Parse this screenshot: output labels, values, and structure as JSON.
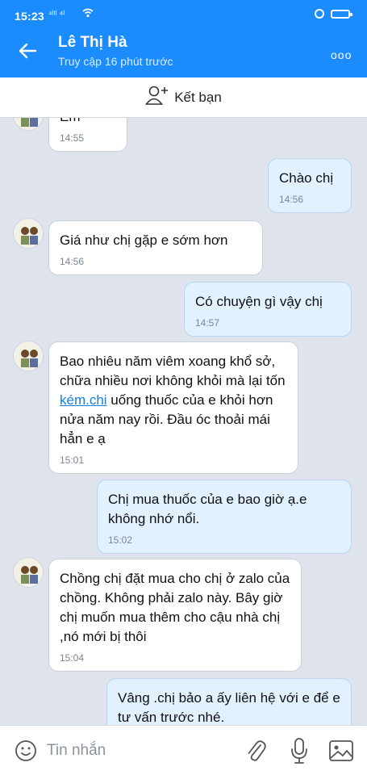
{
  "status_bar": {
    "time": "15:23",
    "signal": "⁴ˡᵗˡ ⁴ˡ"
  },
  "header": {
    "contact_name": "Lê Thị Hà",
    "last_seen": "Truy cập 16 phút trước",
    "more_label": "ooo"
  },
  "add_friend": {
    "label": "Kết bạn"
  },
  "messages": [
    {
      "dir": "in",
      "text": "Em",
      "time": "14:55"
    },
    {
      "dir": "out",
      "text": "Chào chị",
      "time": "14:56"
    },
    {
      "dir": "in",
      "text": "Giá như chị gặp e sớm hơn",
      "time": "14:56"
    },
    {
      "dir": "out",
      "text": "Có chuyện gì vậy chị",
      "time": "14:57"
    },
    {
      "dir": "in",
      "text_before": "Bao nhiêu năm viêm xoang khổ sở, chữa nhiều nơi không khỏi mà lại tốn ",
      "link": "kém.chi",
      "text_after": " uống thuốc của e khỏi hơn nửa năm nay rồi. Đầu óc thoải mái hẳn e ạ",
      "time": "15:01"
    },
    {
      "dir": "out",
      "text": "Chị mua thuốc của e bao giờ ạ.e không nhớ nổi.",
      "time": "15:02"
    },
    {
      "dir": "in",
      "text": "Chồng chị đặt mua cho chị ở zalo của chồng. Không phải zalo này. Bây giờ chị muốn mua thêm cho cậu nhà chị ,nó mới bị thôi",
      "time": "15:04"
    },
    {
      "dir": "out",
      "text": "Vâng .chị bảo a ấy liên hệ với e để e tư vấn trước nhé."
    }
  ],
  "input_bar": {
    "placeholder": "Tin nhắn"
  },
  "colors": {
    "header_blue": "#1a8cff",
    "chat_bg": "#dfe4ec",
    "outgoing_bubble": "#e1f1ff",
    "link": "#1a7fe0"
  }
}
